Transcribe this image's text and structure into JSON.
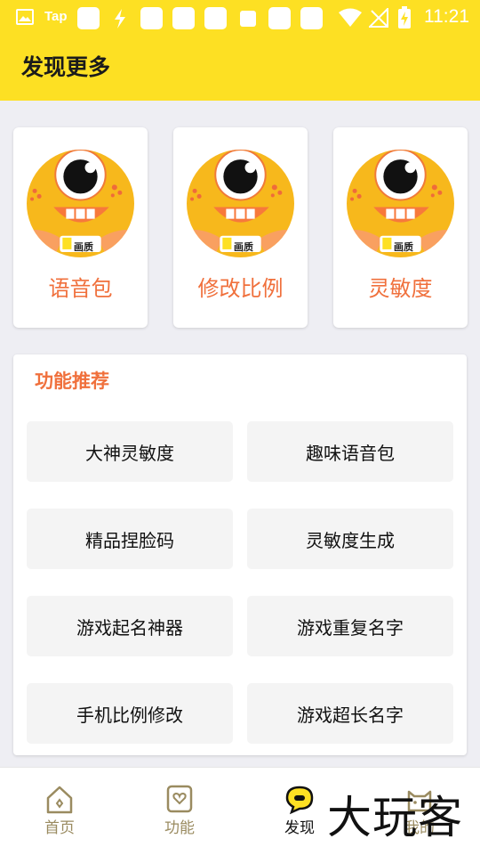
{
  "status_bar": {
    "tap_label": "Tap",
    "time": "11:21"
  },
  "header": {
    "title": "发现更多"
  },
  "colors": {
    "header_bg": "#fde023",
    "accent_orange": "#f0703c",
    "page_bg": "#eeeef3",
    "nav_inactive": "#9a8b60",
    "mascot_yellow": "#f7b81c"
  },
  "cards": [
    {
      "label": "语音包",
      "badge": "画质"
    },
    {
      "label": "修改比例",
      "badge": "画质"
    },
    {
      "label": "灵敏度",
      "badge": "画质"
    }
  ],
  "recommend": {
    "title": "功能推荐",
    "items": [
      "大神灵敏度",
      "趣味语音包",
      "精品捏脸码",
      "灵敏度生成",
      "游戏起名神器",
      "游戏重复名字",
      "手机比例修改",
      "游戏超长名字"
    ]
  },
  "bottom_nav": {
    "items": [
      {
        "label": "首页",
        "icon": "home-icon"
      },
      {
        "label": "功能",
        "icon": "heart-icon"
      },
      {
        "label": "发现",
        "icon": "chat-bubble-icon",
        "active": true
      },
      {
        "label": "我的",
        "icon": "cat-icon"
      }
    ]
  },
  "watermark": "大玩客"
}
